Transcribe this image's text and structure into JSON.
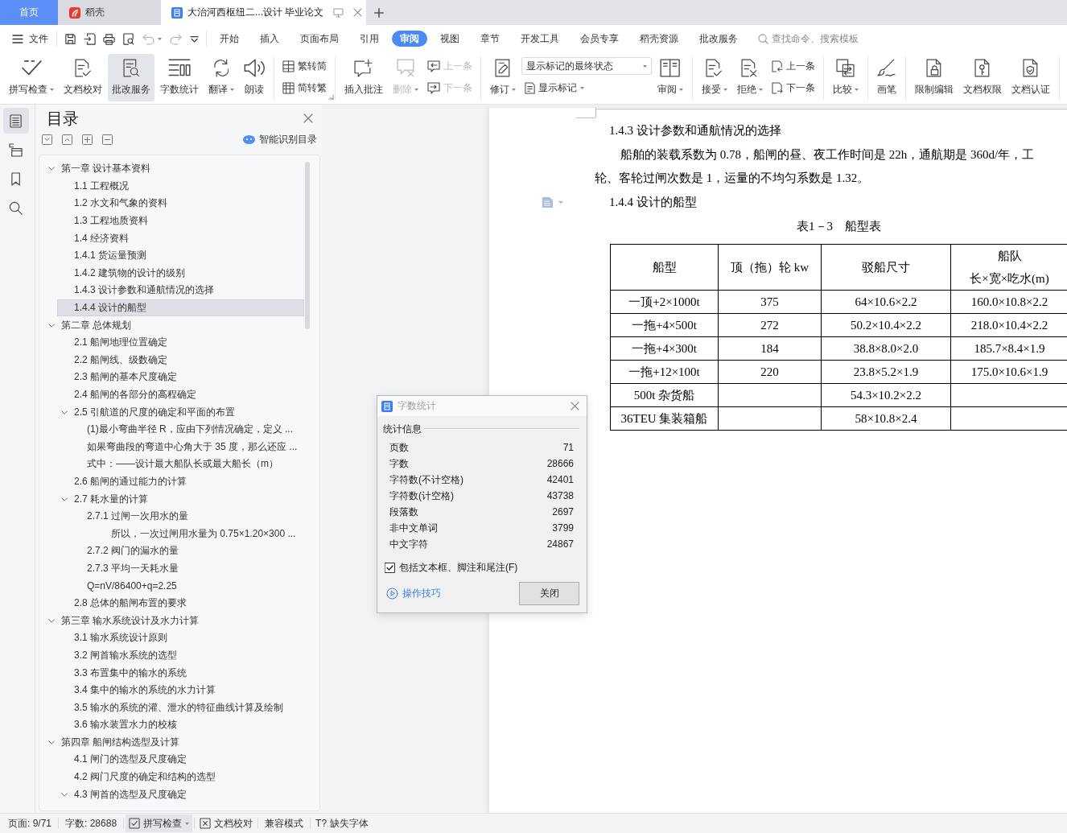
{
  "tabs": [
    {
      "kind": "home",
      "label": "首页",
      "selected": false
    },
    {
      "kind": "app",
      "label": "稻壳",
      "selected": false
    },
    {
      "kind": "document",
      "label": "大治河西枢纽二...设计 毕业论文",
      "selected": true
    }
  ],
  "menu_bar": {
    "file_label": "文件",
    "quick_access": [
      {
        "disabled": false,
        "dropdown": false
      },
      {
        "disabled": false,
        "dropdown": false
      },
      {
        "disabled": false,
        "dropdown": false
      },
      {
        "disabled": false,
        "dropdown": false
      },
      {
        "disabled": true,
        "dropdown": true
      },
      {
        "disabled": true,
        "dropdown": false
      },
      {
        "disabled": false,
        "dropdown": false
      }
    ],
    "menu_tabs": [
      {
        "label": "开始",
        "selected": false
      },
      {
        "label": "插入",
        "selected": false
      },
      {
        "label": "页面布局",
        "selected": false
      },
      {
        "label": "引用",
        "selected": false
      },
      {
        "label": "审阅",
        "selected": true
      },
      {
        "label": "视图",
        "selected": false
      },
      {
        "label": "章节",
        "selected": false
      },
      {
        "label": "开发工具",
        "selected": false
      },
      {
        "label": "会员专享",
        "selected": false
      },
      {
        "label": "稻壳资源",
        "selected": false
      },
      {
        "label": "批改服务",
        "selected": false
      }
    ],
    "search": {
      "placeholder": "查找命令、搜索模板"
    }
  },
  "ribbon": {
    "groups": [
      {
        "launcher": false,
        "items": [
          {
            "kind": "large",
            "label": "拼写检查",
            "dropdown": true,
            "disabled": false,
            "pressed": false
          },
          {
            "kind": "large",
            "label": "文档校对",
            "dropdown": false,
            "disabled": false,
            "pressed": false
          },
          {
            "kind": "large",
            "label": "批改服务",
            "dropdown": false,
            "disabled": false,
            "pressed": true
          },
          {
            "kind": "large",
            "label": "字数统计",
            "dropdown": false,
            "disabled": false,
            "pressed": false
          },
          {
            "kind": "large",
            "label": "翻译",
            "dropdown": true,
            "disabled": false,
            "pressed": false
          },
          {
            "kind": "large",
            "label": "朗读",
            "dropdown": false,
            "disabled": false,
            "pressed": false
          }
        ]
      },
      {
        "launcher": true,
        "items": [
          {
            "kind": "stack",
            "buttons": [
              {
                "kind": "small",
                "label": "繁转简",
                "dropdown": false,
                "disabled": false,
                "pressed": false
              },
              {
                "kind": "small",
                "label": "简转繁",
                "dropdown": false,
                "disabled": false,
                "pressed": false
              }
            ]
          }
        ]
      },
      {
        "launcher": false,
        "items": [
          {
            "kind": "large",
            "label": "插入批注",
            "dropdown": false,
            "disabled": false,
            "pressed": false
          },
          {
            "kind": "large",
            "label": "删除",
            "dropdown": true,
            "disabled": true,
            "pressed": false
          },
          {
            "kind": "stack",
            "buttons": [
              {
                "kind": "small",
                "label": "上一条",
                "dropdown": false,
                "disabled": true,
                "pressed": false
              },
              {
                "kind": "small",
                "label": "下一条",
                "dropdown": false,
                "disabled": true,
                "pressed": false
              }
            ]
          }
        ]
      },
      {
        "launcher": false,
        "items": [
          {
            "kind": "large",
            "label": "修订",
            "dropdown": true,
            "disabled": false,
            "pressed": false
          },
          {
            "kind": "stack",
            "buttons": [
              {
                "kind": "select",
                "value": "显示标记的最终状态"
              },
              {
                "kind": "small",
                "label": "显示标记",
                "dropdown": true,
                "disabled": false,
                "pressed": false
              }
            ]
          },
          {
            "kind": "large",
            "label": "审阅",
            "dropdown": true,
            "disabled": false,
            "pressed": false
          }
        ]
      },
      {
        "launcher": false,
        "items": [
          {
            "kind": "large",
            "label": "接受",
            "dropdown": true,
            "disabled": false,
            "pressed": false
          },
          {
            "kind": "large",
            "label": "拒绝",
            "dropdown": true,
            "disabled": false,
            "pressed": false
          },
          {
            "kind": "stack",
            "buttons": [
              {
                "kind": "small",
                "label": "上一条",
                "dropdown": false,
                "disabled": false,
                "pressed": false
              },
              {
                "kind": "small",
                "label": "下一条",
                "dropdown": false,
                "disabled": false,
                "pressed": false
              }
            ]
          }
        ]
      },
      {
        "launcher": false,
        "items": [
          {
            "kind": "large",
            "label": "比较",
            "dropdown": true,
            "disabled": false,
            "pressed": false
          }
        ]
      },
      {
        "launcher": false,
        "items": [
          {
            "kind": "large",
            "label": "画笔",
            "dropdown": false,
            "disabled": false,
            "pressed": false
          }
        ]
      },
      {
        "launcher": false,
        "items": [
          {
            "kind": "large",
            "label": "限制编辑",
            "dropdown": false,
            "disabled": false,
            "pressed": false
          },
          {
            "kind": "large",
            "label": "文档权限",
            "dropdown": false,
            "disabled": false,
            "pressed": false
          },
          {
            "kind": "large",
            "label": "文档认证",
            "dropdown": false,
            "disabled": false,
            "pressed": false
          }
        ]
      }
    ]
  },
  "nav_strip": {
    "items": [
      {
        "selected": true
      },
      {
        "selected": false
      },
      {
        "selected": false
      },
      {
        "selected": false
      }
    ]
  },
  "toc": {
    "title": "目录",
    "smart_button": "智能识别目录",
    "items": [
      {
        "label": "第一章 设计基本资料",
        "selected": false,
        "expanded": true,
        "children": [
          {
            "label": "1.1 工程概况",
            "selected": false
          },
          {
            "label": "1.2 水文和气象的资料",
            "selected": false
          },
          {
            "label": "1.3 工程地质资料",
            "selected": false
          },
          {
            "label": "1.4 经济资料",
            "selected": false
          },
          {
            "label": "1.4.1 货运量预测",
            "selected": false
          },
          {
            "label": "1.4.2 建筑物的设计的级别",
            "selected": false
          },
          {
            "label": "1.4.3 设计参数和通航情况的选择",
            "selected": false
          },
          {
            "label": "1.4.4 设计的船型",
            "selected": true
          }
        ]
      },
      {
        "label": "第二章 总体规划",
        "selected": false,
        "expanded": true,
        "children": [
          {
            "label": "2.1 船闸地理位置确定",
            "selected": false
          },
          {
            "label": "2.2 船闸线、级数确定",
            "selected": false
          },
          {
            "label": "2.3 船闸的基本尺度确定",
            "selected": false
          },
          {
            "label": "2.4 船闸的各部分的高程确定",
            "selected": false
          },
          {
            "label": "2.5 引航道的尺度的确定和平面的布置",
            "selected": false,
            "expanded": true,
            "children": [
              {
                "label": "(1)最小弯曲半径 R，应由下列情况确定，定义 ...",
                "selected": false
              },
              {
                "label": "如果弯曲段的弯道中心角大于 35 度，那么还应 ...",
                "selected": false
              },
              {
                "label": "式中：——设计最大船队长或最大船长（m）",
                "selected": false
              }
            ]
          },
          {
            "label": "2.6 船闸的通过能力的计算",
            "selected": false
          },
          {
            "label": "2.7 耗水量的计算",
            "selected": false,
            "expanded": true,
            "children": [
              {
                "label": "2.7.1 过闸一次用水的量",
                "selected": false,
                "children": [
                  {
                    "label": "所以，一次过闸用水量为 0.75×1.20×300 ...",
                    "selected": false
                  }
                ]
              },
              {
                "label": "2.7.2 阀门的漏水的量",
                "selected": false
              },
              {
                "label": "2.7.3 平均一天耗水量",
                "selected": false
              },
              {
                "label": "Q=nV/86400+q=2.25",
                "selected": false
              }
            ]
          },
          {
            "label": "2.8 总体的船闸布置的要求",
            "selected": false
          }
        ]
      },
      {
        "label": "第三章 输水系统设计及水力计算",
        "selected": false,
        "expanded": true,
        "children": [
          {
            "label": "3.1 输水系统设计原则",
            "selected": false
          },
          {
            "label": "3.2 闸首输水系统的选型",
            "selected": false
          },
          {
            "label": "3.3 布置集中的输水的系统",
            "selected": false
          },
          {
            "label": "3.4 集中的输水的系统的水力计算",
            "selected": false
          },
          {
            "label": "3.5 输水的系统的灌、泄水的特征曲线计算及绘制",
            "selected": false
          },
          {
            "label": "3.6 输水装置水力的校核",
            "selected": false
          }
        ]
      },
      {
        "label": "第四章 船闸结构选型及计算",
        "selected": false,
        "expanded": true,
        "children": [
          {
            "label": "4.1 闸门的选型及尺度确定",
            "selected": false
          },
          {
            "label": "4.2 阀门尺度的确定和结构的选型",
            "selected": false
          },
          {
            "label": "4.3 闸首的选型及尺度确定",
            "selected": false,
            "expanded": true
          }
        ]
      }
    ]
  },
  "document": {
    "blocks": [
      {
        "kind": "heading",
        "text": "1.4.3 设计参数和通航情况的选择",
        "margin_icon": false
      },
      {
        "kind": "paragraph",
        "lines": [
          "船舶的装载系数为 0.78，船闸的昼、夜工作时间是 22h，通航期是 360d/年，工",
          "轮、客轮过闸次数是 1，运量的不均匀系数是 1.32。"
        ]
      },
      {
        "kind": "heading",
        "text": "1.4.4 设计的船型",
        "margin_icon": true
      },
      {
        "kind": "caption",
        "text": "表1－3　船型表"
      },
      {
        "kind": "table",
        "columns": [
          {
            "label": "船型"
          },
          {
            "label": "顶（拖）轮 kw"
          },
          {
            "label": "驳船尺寸"
          },
          {
            "label": "船队",
            "sublabel": "长×宽×吃水(m)"
          }
        ],
        "rows": [
          [
            "一顶+2×1000t",
            "375",
            "64×10.6×2.2",
            "160.0×10.8×2.2"
          ],
          [
            "一拖+4×500t",
            "272",
            "50.2×10.4×2.2",
            "218.0×10.4×2.2"
          ],
          [
            "一拖+4×300t",
            "184",
            "38.8×8.0×2.0",
            "185.7×8.4×1.9"
          ],
          [
            "一拖+12×100t",
            "220",
            "23.8×5.2×1.9",
            "175.0×10.6×1.9"
          ],
          [
            "500t 杂货船",
            null,
            "54.3×10.2×2.2",
            null
          ],
          [
            "36TEU 集装箱船",
            null,
            "58×10.8×2.4",
            null
          ]
        ]
      }
    ]
  },
  "word_count_dialog": {
    "title": "字数统计",
    "section": "统计信息",
    "stats": [
      {
        "label": "页数",
        "value": "71"
      },
      {
        "label": "字数",
        "value": "28666"
      },
      {
        "label": "字符数(不计空格)",
        "value": "42401"
      },
      {
        "label": "字符数(计空格)",
        "value": "43738"
      },
      {
        "label": "段落数",
        "value": "2697"
      },
      {
        "label": "非中文单词",
        "value": "3799"
      },
      {
        "label": "中文字符",
        "value": "24867"
      }
    ],
    "include_option": {
      "label": "包括文本框、脚注和尾注(F)",
      "checked": true
    },
    "tips_link": "操作技巧",
    "close_button": "关闭"
  },
  "status_bar": {
    "items": [
      {
        "kind": "text",
        "label": "页面: 9/71"
      },
      {
        "kind": "text",
        "label": "字数: 28688"
      },
      {
        "kind": "button",
        "label": "拼写检查",
        "dropdown": true,
        "active": true
      },
      {
        "kind": "button",
        "label": "文档校对",
        "dropdown": false,
        "active": false
      },
      {
        "kind": "text",
        "label": "兼容模式"
      },
      {
        "kind": "glyph",
        "glyph": "T?",
        "label": "缺失字体"
      }
    ]
  }
}
